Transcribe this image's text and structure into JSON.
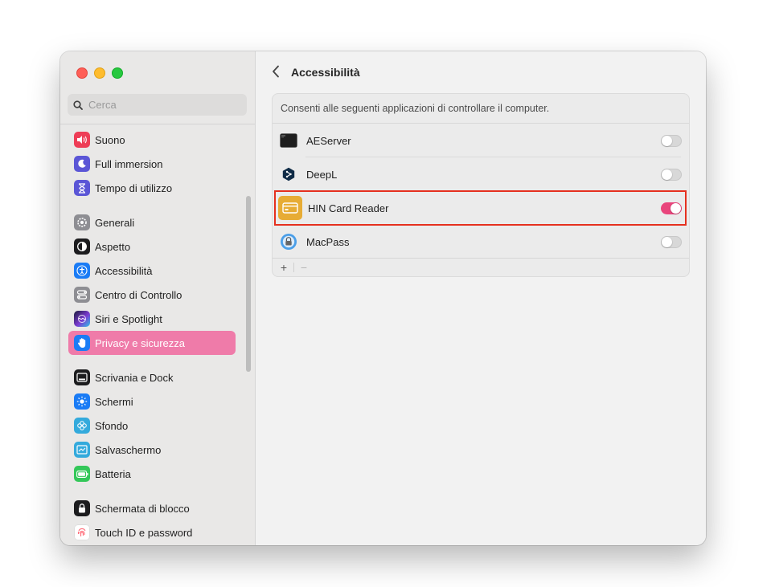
{
  "search": {
    "placeholder": "Cerca"
  },
  "sidebar": {
    "items": [
      {
        "label": "Suono",
        "icon": "speaker-icon",
        "color": "#ee3d56"
      },
      {
        "label": "Full immersion",
        "icon": "moon-icon",
        "color": "#5b56d6"
      },
      {
        "label": "Tempo di utilizzo",
        "icon": "hourglass-icon",
        "color": "#5b56d6"
      },
      {
        "label": "Generali",
        "icon": "gear-icon",
        "color": "#8e8e93"
      },
      {
        "label": "Aspetto",
        "icon": "appearance-icon",
        "color": "#1c1c1e"
      },
      {
        "label": "Accessibilità",
        "icon": "accessibility-icon",
        "color": "#1b7cf5"
      },
      {
        "label": "Centro di Controllo",
        "icon": "control-center-icon",
        "color": "#8e8e93"
      },
      {
        "label": "Siri e Spotlight",
        "icon": "siri-icon",
        "color": "#3a3a8c"
      },
      {
        "label": "Privacy e sicurezza",
        "icon": "hand-icon",
        "color": "#1b7cf5"
      },
      {
        "label": "Scrivania e Dock",
        "icon": "dock-icon",
        "color": "#1c1c1e"
      },
      {
        "label": "Schermi",
        "icon": "sun-icon",
        "color": "#1b7cf5"
      },
      {
        "label": "Sfondo",
        "icon": "flower-icon",
        "color": "#34aadc"
      },
      {
        "label": "Salvaschermo",
        "icon": "screensaver-icon",
        "color": "#34aadc"
      },
      {
        "label": "Batteria",
        "icon": "battery-icon",
        "color": "#34c759"
      },
      {
        "label": "Schermata di blocco",
        "icon": "lock-icon",
        "color": "#1c1c1e"
      },
      {
        "label": "Touch ID e password",
        "icon": "fingerprint-icon",
        "color": "#ff6b6b"
      }
    ],
    "active_index": 8
  },
  "main": {
    "title": "Accessibilità",
    "description": "Consenti alle seguenti applicazioni di controllare il computer.",
    "apps": [
      {
        "name": "AEServer",
        "enabled": false,
        "icon": "terminal-icon"
      },
      {
        "name": "DeepL",
        "enabled": false,
        "icon": "deepl-icon"
      },
      {
        "name": "HIN Card Reader",
        "enabled": true,
        "icon": "card-reader-icon"
      },
      {
        "name": "MacPass",
        "enabled": false,
        "icon": "macpass-icon"
      }
    ],
    "add_label": "+",
    "remove_label": "−"
  },
  "colors": {
    "accent": "#ef7ba9",
    "toggle_on": "#e9457c",
    "highlight": "#e5301f"
  }
}
